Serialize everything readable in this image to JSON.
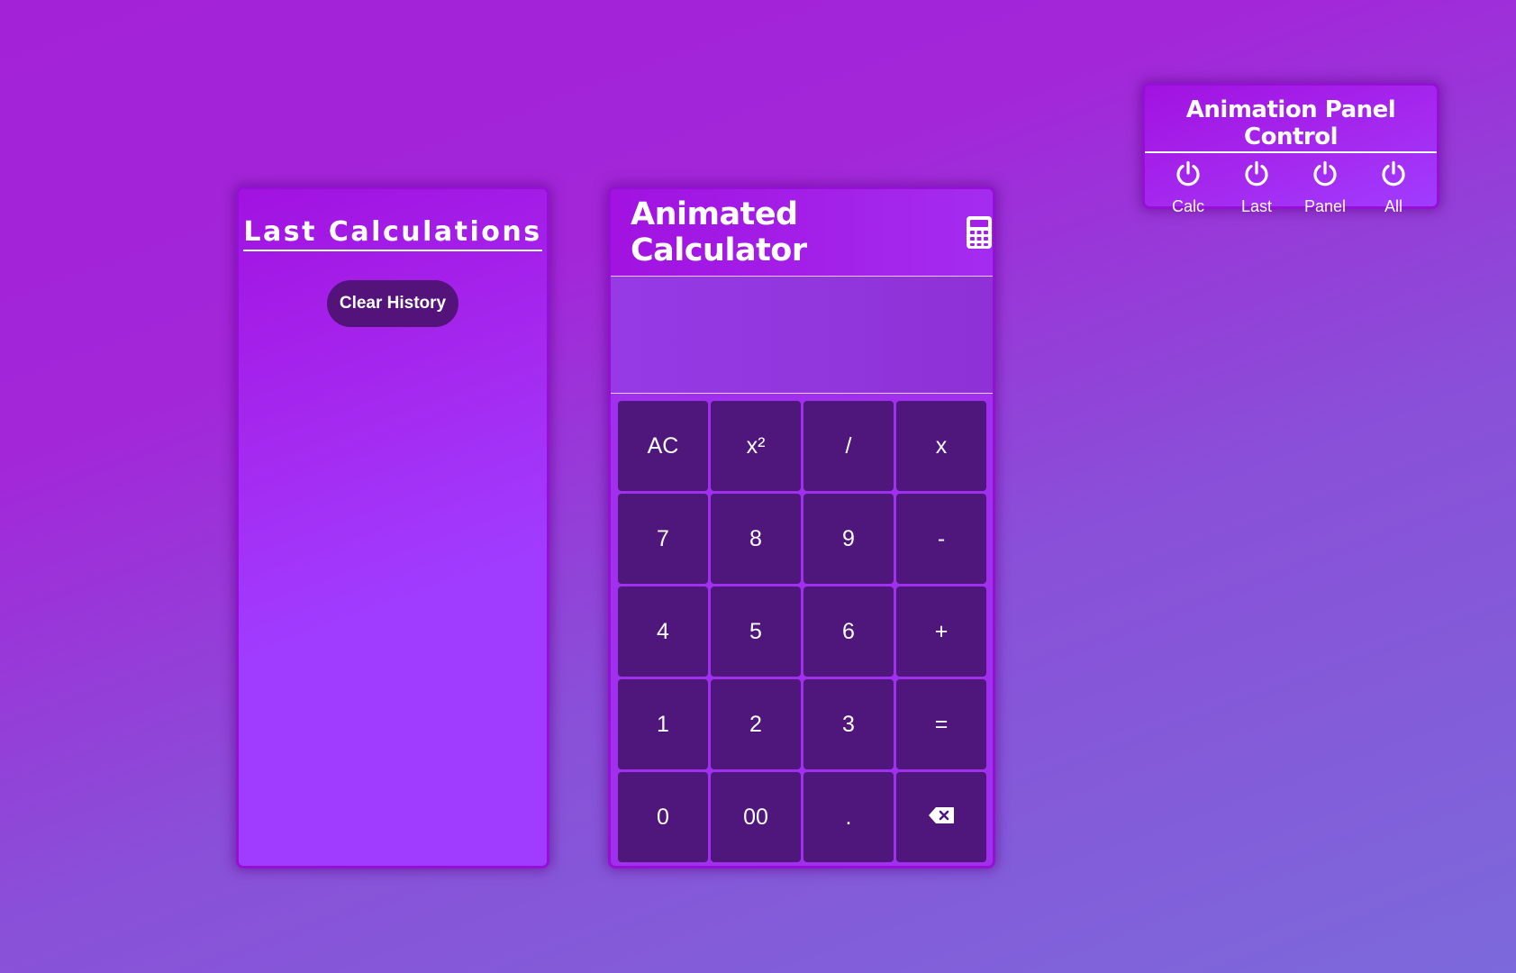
{
  "history": {
    "title": "Last Calculations",
    "clear_label": "Clear History"
  },
  "calculator": {
    "title": "Animated Calculator",
    "icon": "calculator-icon",
    "display": "",
    "keys": [
      {
        "label": "AC",
        "name": "key-clear-all"
      },
      {
        "label": "x²",
        "name": "key-square"
      },
      {
        "label": "/",
        "name": "key-divide"
      },
      {
        "label": "x",
        "name": "key-multiply"
      },
      {
        "label": "7",
        "name": "key-7"
      },
      {
        "label": "8",
        "name": "key-8"
      },
      {
        "label": "9",
        "name": "key-9"
      },
      {
        "label": "-",
        "name": "key-subtract"
      },
      {
        "label": "4",
        "name": "key-4"
      },
      {
        "label": "5",
        "name": "key-5"
      },
      {
        "label": "6",
        "name": "key-6"
      },
      {
        "label": "+",
        "name": "key-add"
      },
      {
        "label": "1",
        "name": "key-1"
      },
      {
        "label": "2",
        "name": "key-2"
      },
      {
        "label": "3",
        "name": "key-3"
      },
      {
        "label": "=",
        "name": "key-equals"
      },
      {
        "label": "0",
        "name": "key-0"
      },
      {
        "label": "00",
        "name": "key-double-zero"
      },
      {
        "label": ".",
        "name": "key-decimal"
      },
      {
        "label": "",
        "name": "key-backspace",
        "icon": "backspace-icon"
      }
    ]
  },
  "animation_panel": {
    "title": "Animation Panel Control",
    "toggles": [
      {
        "label": "Calc",
        "icon": "power-icon"
      },
      {
        "label": "Last",
        "icon": "power-icon"
      },
      {
        "label": "Panel",
        "icon": "power-icon"
      },
      {
        "label": "All",
        "icon": "power-icon"
      }
    ]
  },
  "colors": {
    "key_bg": "#4f177c",
    "panel_border": "#9410d4",
    "clear_button_bg": "#53137a"
  }
}
